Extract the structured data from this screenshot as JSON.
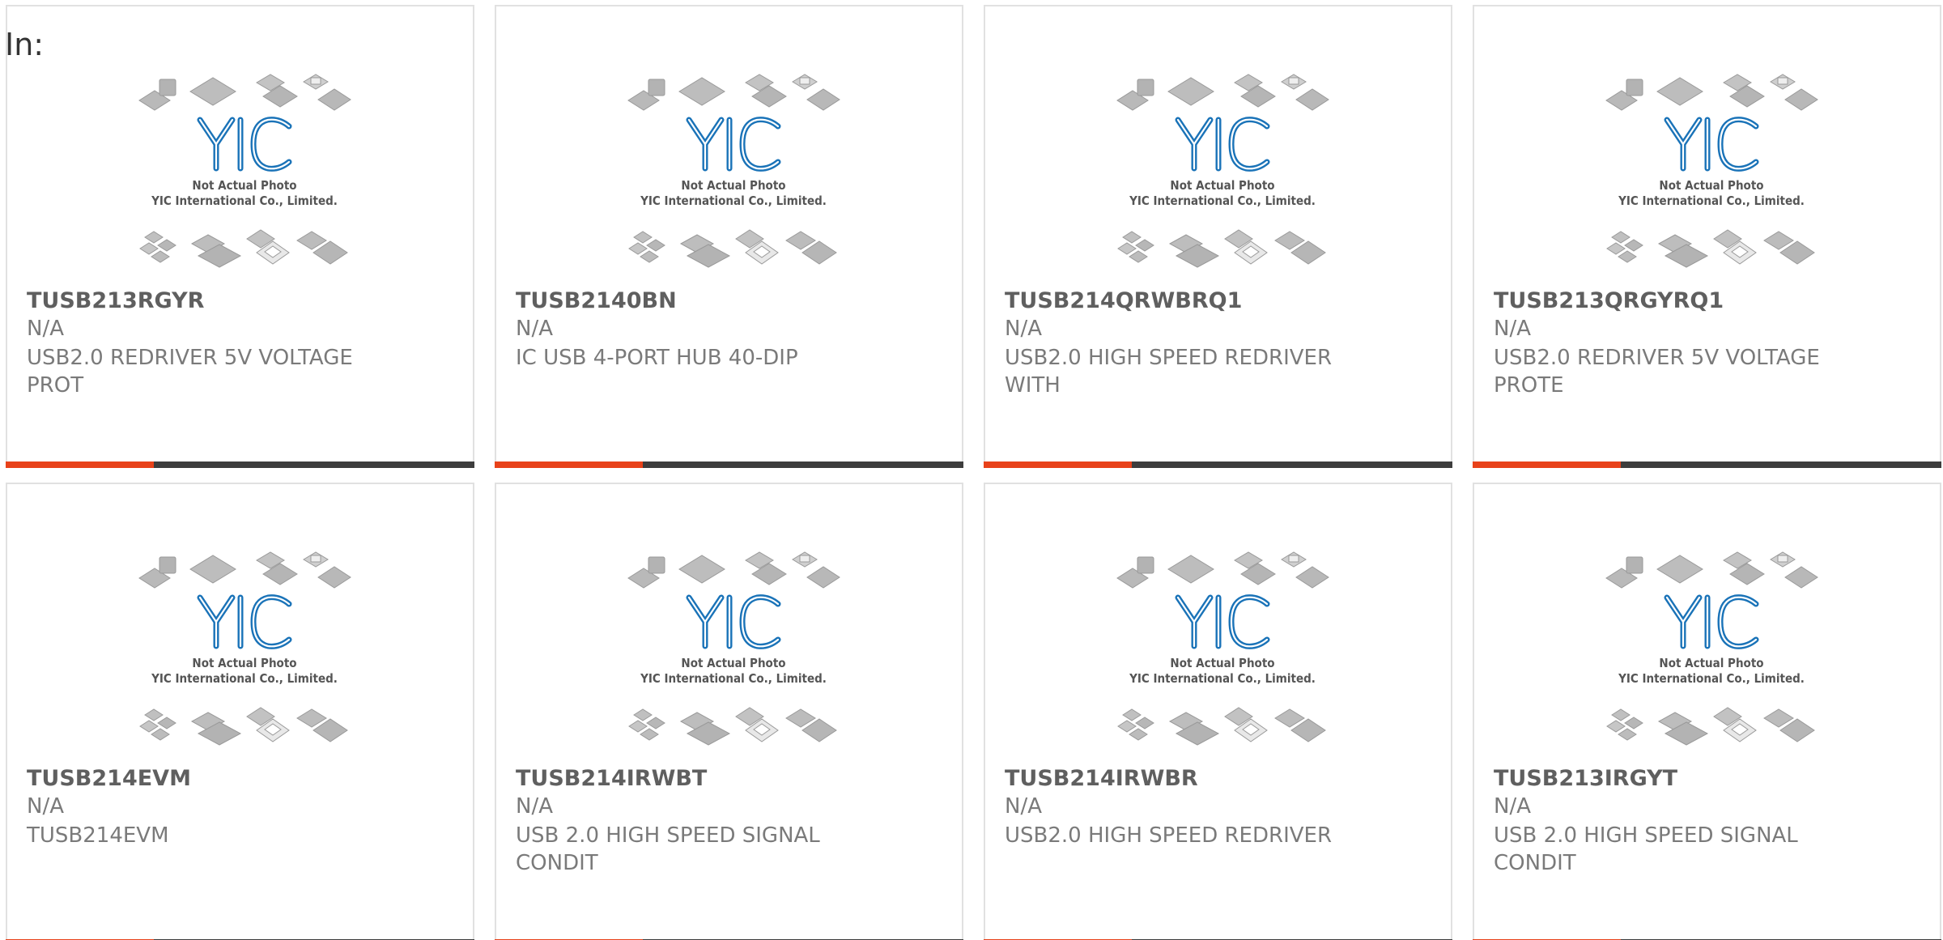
{
  "filter_label": "In:",
  "photo": {
    "caption_line1": "Not Actual Photo",
    "caption_line2": "YIC International Co., Limited.",
    "logo_text": "YIC"
  },
  "colors": {
    "accent": "#e8421a",
    "bar": "#3d3d3d",
    "logo": "#1a73b8"
  },
  "products": [
    {
      "part_number": "TUSB213RGYR",
      "manufacturer": "N/A",
      "description": "USB2.0 REDRIVER 5V VOLTAGE PROT"
    },
    {
      "part_number": "TUSB2140BN",
      "manufacturer": "N/A",
      "description": "IC USB 4-PORT HUB 40-DIP"
    },
    {
      "part_number": "TUSB214QRWBRQ1",
      "manufacturer": "N/A",
      "description": "USB2.0 HIGH SPEED REDRIVER WITH"
    },
    {
      "part_number": "TUSB213QRGYRQ1",
      "manufacturer": "N/A",
      "description": "USB2.0 REDRIVER 5V VOLTAGE PROTE"
    },
    {
      "part_number": "TUSB214EVM",
      "manufacturer": "N/A",
      "description": "TUSB214EVM"
    },
    {
      "part_number": "TUSB214IRWBT",
      "manufacturer": "N/A",
      "description": "USB 2.0 HIGH SPEED SIGNAL CONDIT"
    },
    {
      "part_number": "TUSB214IRWBR",
      "manufacturer": "N/A",
      "description": "USB2.0 HIGH SPEED REDRIVER"
    },
    {
      "part_number": "TUSB213IRGYT",
      "manufacturer": "N/A",
      "description": "USB 2.0 HIGH SPEED SIGNAL CONDIT"
    }
  ]
}
